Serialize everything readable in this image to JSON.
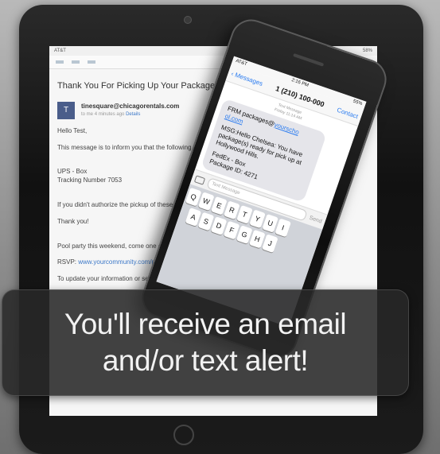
{
  "email": {
    "status_carrier": "AT&T",
    "status_battery": "58%",
    "subject": "Thank You For Picking Up Your Package",
    "avatar_letter": "T",
    "sender": "tinesquare@chicagorentals.com",
    "sender_to": "to me",
    "sender_time": "4 minutes ago",
    "sender_details": "Details",
    "greeting": "Hello Test,",
    "line_intro": "This message is to inform you that the following package(s) have been",
    "carrier_line": "UPS - Box",
    "tracking_line": "Tracking Number 7053",
    "line_authorize": "If you didn't authorize the pickup of these package(s), pl",
    "thanks": "Thank you!",
    "party_line": "Pool party this weekend, come one come all!",
    "rsvp_label": "RSVP:",
    "rsvp_link": "www.yourcommunity.com/poolparty",
    "update_line": "To update your information or settings click"
  },
  "phone": {
    "carrier": "AT&T",
    "time": "2:16 PM",
    "battery": "55%",
    "back_label": "Messages",
    "title": "1 (210) 100-000",
    "contact_label": "Contact",
    "meta_type": "Text Message",
    "meta_time": "Friday 11:14 AM",
    "msg_from": "FRM packages@",
    "msg_from_link": "yourscho ol.com",
    "msg_body": "MSG:Hello Chelsea: You have package(s) ready for pick up at Hollywood Hills.",
    "msg_carrier": "FedEx - Box",
    "msg_package": "Package ID: 4271",
    "input_placeholder": "Text Message",
    "send_label": "Send",
    "keys_row1": [
      "Q",
      "W",
      "E",
      "R",
      "T",
      "Y",
      "U",
      "I"
    ],
    "keys_row2": [
      "A",
      "S",
      "D",
      "F",
      "G",
      "H",
      "J"
    ]
  },
  "banner": {
    "line1": "You'll receive an email",
    "line2": "and/or text alert!"
  }
}
